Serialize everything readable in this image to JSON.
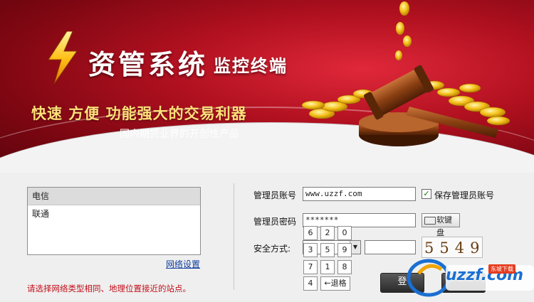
{
  "banner": {
    "title_main": "资管系统",
    "title_sub": "监控终端",
    "slogan": "快速 方便 功能强大的交易利器",
    "subslogan": "国内期货业界的开创性产品"
  },
  "servers": {
    "items": [
      "电信",
      "联通"
    ],
    "selected_index": 0,
    "network_settings_link": "网络设置",
    "hint": "请选择网络类型相同、地理位置接近的站点。"
  },
  "login": {
    "account_label": "管理员账号",
    "account_value": "www.uzzf.com",
    "save_account_label": "保存管理员账号",
    "save_account_checked": true,
    "password_label": "管理员密码",
    "password_value": "*******",
    "soft_keyboard_label": "软键盘",
    "security_label": "安全方式:",
    "security_value": "",
    "captcha_input": "",
    "captcha_text": "5549",
    "login_button_label": "登"
  },
  "keypad": {
    "keys": [
      "6",
      "2",
      "0",
      "3",
      "5",
      "9",
      "7",
      "1",
      "8",
      "4"
    ],
    "backspace_label": "←退格"
  },
  "watermark": {
    "logo_text": "uzzf.com",
    "badge": "东坡下载"
  },
  "colors": {
    "banner_red": "#b0101f",
    "slogan_gold": "#ffe07a",
    "link_blue": "#0f3d9e",
    "hint_red": "#c0101a"
  },
  "icons": [
    "lightning-bolt-logo-icon",
    "gavel-coins-illustration",
    "keyboard-icon",
    "checkbox-check-icon",
    "dropdown-arrow-icon"
  ]
}
